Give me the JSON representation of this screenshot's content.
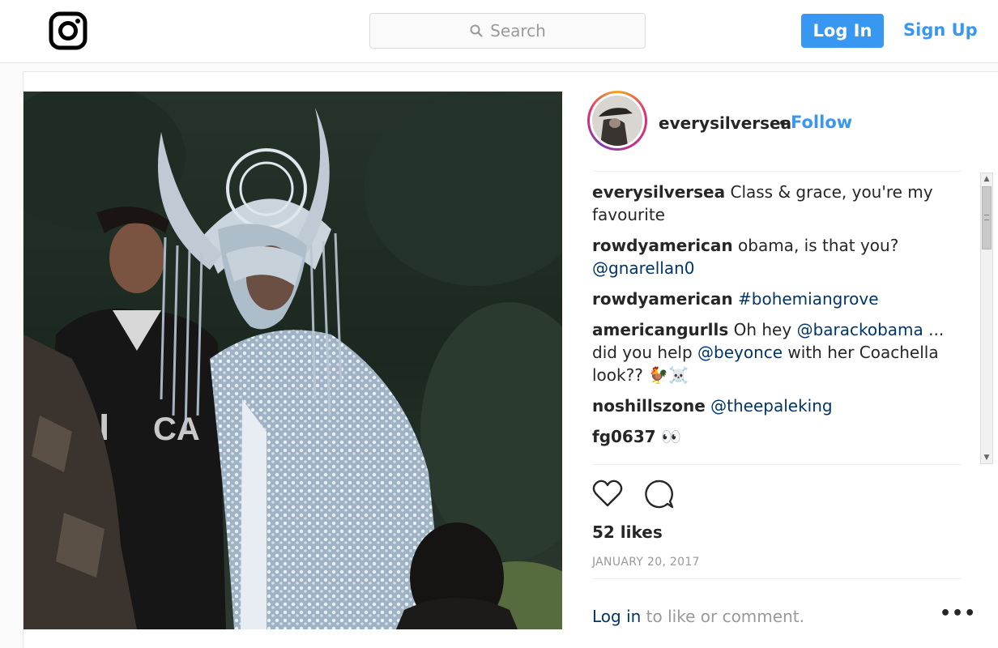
{
  "header": {
    "logo": "instagram-logo-icon",
    "search_placeholder": "Search",
    "login_label": "Log In",
    "signup_label": "Sign Up"
  },
  "post": {
    "username": "everysilversea",
    "separator": "•",
    "follow_label": "Follow",
    "comments": [
      {
        "user": "everysilversea",
        "parts": [
          {
            "text": "Class & grace, you're my favourite",
            "link": false
          }
        ]
      },
      {
        "user": "rowdyamerican",
        "parts": [
          {
            "text": "obama, is that you? ",
            "link": false
          },
          {
            "text": "@gnarellan0",
            "link": true
          }
        ]
      },
      {
        "user": "rowdyamerican",
        "parts": [
          {
            "text": "#bohemiangrove",
            "link": true
          }
        ]
      },
      {
        "user": "americangurlls",
        "parts": [
          {
            "text": "Oh hey ",
            "link": false
          },
          {
            "text": "@barackobama",
            "link": true
          },
          {
            "text": " ... did you help ",
            "link": false
          },
          {
            "text": "@beyonce",
            "link": true
          },
          {
            "text": " with her Coachella look?? 🐓☠️",
            "link": false
          }
        ]
      },
      {
        "user": "noshillszone",
        "parts": [
          {
            "text": "@theepaleking",
            "link": true
          }
        ]
      },
      {
        "user": "fg0637",
        "parts": [
          {
            "text": "👀",
            "link": false
          }
        ]
      }
    ],
    "likes": "52 likes",
    "date": "JANUARY 20, 2017",
    "footer_login_link": "Log in",
    "footer_login_rest": " to like or comment.",
    "more_label": "•••"
  },
  "icons": {
    "like": "heart-icon",
    "comment": "comment-icon",
    "search": "search-icon"
  },
  "colors": {
    "accent": "#3897f0",
    "link": "#003569",
    "muted": "#999999"
  }
}
